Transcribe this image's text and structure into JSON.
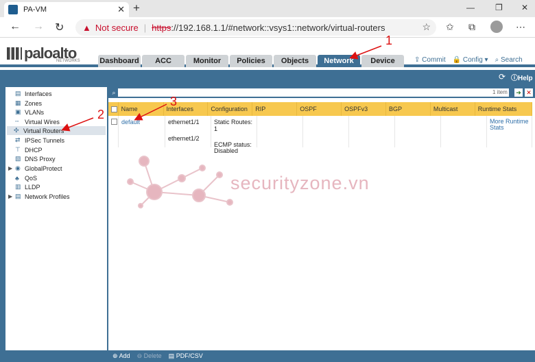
{
  "browser": {
    "tab_title": "PA-VM",
    "url_warning": "Not secure",
    "url_scheme": "https",
    "url_rest": "://192.168.1.1/#network::vsys1::network/virtual-routers"
  },
  "header": {
    "logo_text": "paloalto",
    "logo_sub": "NETWORKS",
    "tabs": [
      "Dashboard",
      "ACC",
      "Monitor",
      "Policies",
      "Objects",
      "Network",
      "Device"
    ],
    "active_tab": "Network",
    "actions": {
      "commit": "Commit",
      "config": "Config",
      "search": "Search"
    },
    "help": "Help"
  },
  "sidebar": {
    "items": [
      {
        "label": "Interfaces"
      },
      {
        "label": "Zones"
      },
      {
        "label": "VLANs"
      },
      {
        "label": "Virtual Wires"
      },
      {
        "label": "Virtual Routers"
      },
      {
        "label": "IPSec Tunnels"
      },
      {
        "label": "DHCP"
      },
      {
        "label": "DNS Proxy"
      },
      {
        "label": "GlobalProtect"
      },
      {
        "label": "QoS"
      },
      {
        "label": "LLDP"
      },
      {
        "label": "Network Profiles"
      }
    ],
    "selected": "Virtual Routers"
  },
  "table": {
    "item_count": "1 item",
    "columns": [
      "Name",
      "Interfaces",
      "Configuration",
      "RIP",
      "OSPF",
      "OSPFv3",
      "BGP",
      "Multicast",
      "Runtime Stats"
    ],
    "row": {
      "name": "default",
      "interfaces": [
        "ethernet1/1",
        "ethernet1/2"
      ],
      "configuration": [
        "Static Routes: 1",
        "ECMP status: Disabled"
      ],
      "runtime": "More Runtime Stats"
    }
  },
  "watermark": "securityzone.vn",
  "bottom": {
    "add": "Add",
    "delete": "Delete",
    "pdf": "PDF/CSV"
  },
  "callouts": [
    "1",
    "2",
    "3"
  ]
}
